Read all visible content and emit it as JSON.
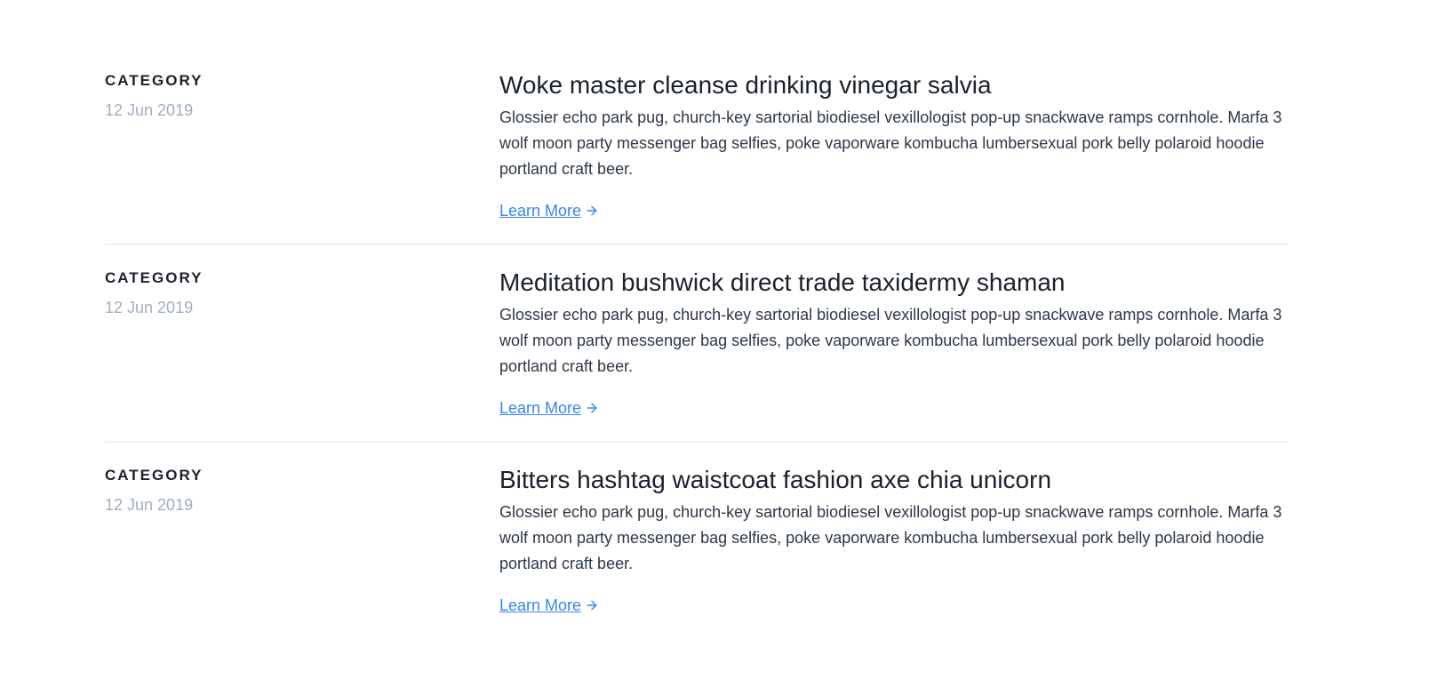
{
  "colors": {
    "heading": "#1a202c",
    "body": "#2d3748",
    "muted": "#a0aec0",
    "link": "#3b82f6",
    "divider": "#edf2f7"
  },
  "posts": [
    {
      "category": "CATEGORY",
      "date": "12 Jun 2019",
      "title": "Woke master cleanse drinking vinegar salvia",
      "body": "Glossier echo park pug, church-key sartorial biodiesel vexillologist pop-up snackwave ramps cornhole. Marfa 3 wolf moon party messenger bag selfies, poke vaporware kombucha lumbersexual pork belly polaroid hoodie portland craft beer.",
      "link_label": "Learn More",
      "link_icon": "arrow-right-icon"
    },
    {
      "category": "CATEGORY",
      "date": "12 Jun 2019",
      "title": "Meditation bushwick direct trade taxidermy shaman",
      "body": "Glossier echo park pug, church-key sartorial biodiesel vexillologist pop-up snackwave ramps cornhole. Marfa 3 wolf moon party messenger bag selfies, poke vaporware kombucha lumbersexual pork belly polaroid hoodie portland craft beer.",
      "link_label": "Learn More",
      "link_icon": "arrow-right-icon"
    },
    {
      "category": "CATEGORY",
      "date": "12 Jun 2019",
      "title": "Bitters hashtag waistcoat fashion axe chia unicorn",
      "body": "Glossier echo park pug, church-key sartorial biodiesel vexillologist pop-up snackwave ramps cornhole. Marfa 3 wolf moon party messenger bag selfies, poke vaporware kombucha lumbersexual pork belly polaroid hoodie portland craft beer.",
      "link_label": "Learn More",
      "link_icon": "arrow-right-icon"
    }
  ]
}
